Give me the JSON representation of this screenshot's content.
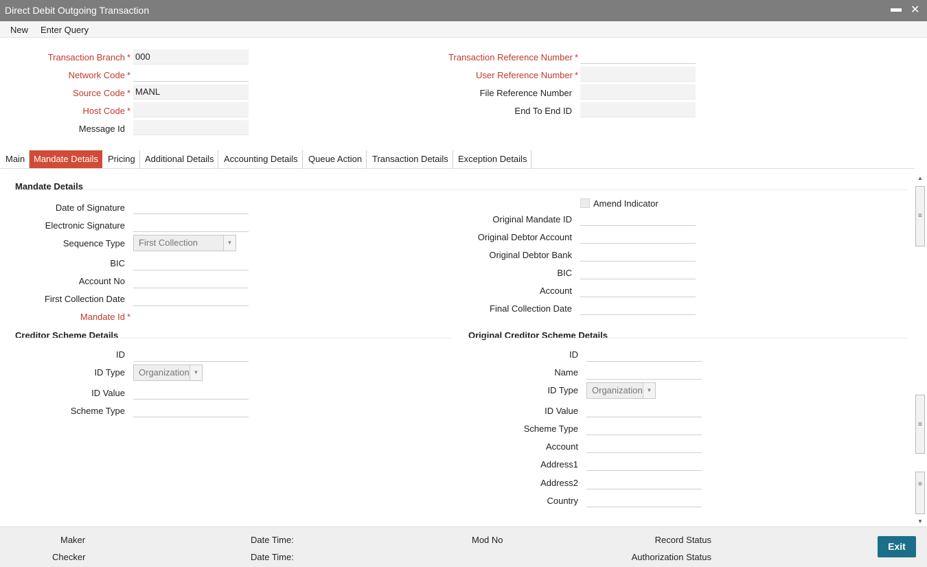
{
  "window": {
    "title": "Direct Debit Outgoing Transaction"
  },
  "menu": {
    "new": "New",
    "enter_query": "Enter Query"
  },
  "header": {
    "transaction_branch": {
      "label": "Transaction Branch",
      "value": "000"
    },
    "network_code": {
      "label": "Network Code",
      "value": ""
    },
    "source_code": {
      "label": "Source Code",
      "value": "MANL"
    },
    "host_code": {
      "label": "Host Code",
      "value": ""
    },
    "message_id": {
      "label": "Message Id",
      "value": ""
    },
    "transaction_reference_number": {
      "label": "Transaction Reference Number",
      "value": ""
    },
    "user_reference_number": {
      "label": "User Reference Number",
      "value": ""
    },
    "file_reference_number": {
      "label": "File Reference Number",
      "value": ""
    },
    "end_to_end_id": {
      "label": "End To End ID",
      "value": ""
    }
  },
  "tabs": [
    {
      "label": "Main"
    },
    {
      "label": "Mandate Details"
    },
    {
      "label": "Pricing"
    },
    {
      "label": "Additional Details"
    },
    {
      "label": "Accounting Details"
    },
    {
      "label": "Queue Action"
    },
    {
      "label": "Transaction Details"
    },
    {
      "label": "Exception Details"
    }
  ],
  "active_tab": "Mandate Details",
  "mandate": {
    "section_title": "Mandate Details",
    "date_of_signature": "Date of Signature",
    "electronic_signature": "Electronic Signature",
    "sequence_type": {
      "label": "Sequence Type",
      "value": "First Collection"
    },
    "bic": "BIC",
    "account_no": "Account No",
    "first_collection_date": "First Collection Date",
    "mandate_id": "Mandate Id",
    "amend_indicator": "Amend Indicator",
    "original_mandate_id": "Original Mandate ID",
    "original_debtor_account": "Original Debtor Account",
    "original_debtor_bank": "Original Debtor Bank",
    "bic_right": "BIC",
    "account_right": "Account",
    "final_collection_date": "Final Collection Date"
  },
  "creditor": {
    "section_title": "Creditor Scheme Details",
    "id": "ID",
    "id_type": {
      "label": "ID Type",
      "value": "Organization"
    },
    "id_value": "ID Value",
    "scheme_type": "Scheme Type"
  },
  "original_creditor": {
    "section_title": "Original Creditor Scheme Details",
    "id": "ID",
    "name": "Name",
    "id_type": {
      "label": "ID Type",
      "value": "Organization"
    },
    "id_value": "ID Value",
    "scheme_type": "Scheme Type",
    "account": "Account",
    "address1": "Address1",
    "address2": "Address2",
    "country": "Country"
  },
  "footer": {
    "maker": "Maker",
    "checker": "Checker",
    "date_time_1": "Date Time:",
    "date_time_2": "Date Time:",
    "mod_no": "Mod No",
    "record_status": "Record Status",
    "authorization_status": "Authorization Status",
    "exit": "Exit"
  },
  "colors": {
    "accent_red": "#d14b36",
    "exit_button": "#1b6f87",
    "title_bar": "#7d7d7d"
  }
}
